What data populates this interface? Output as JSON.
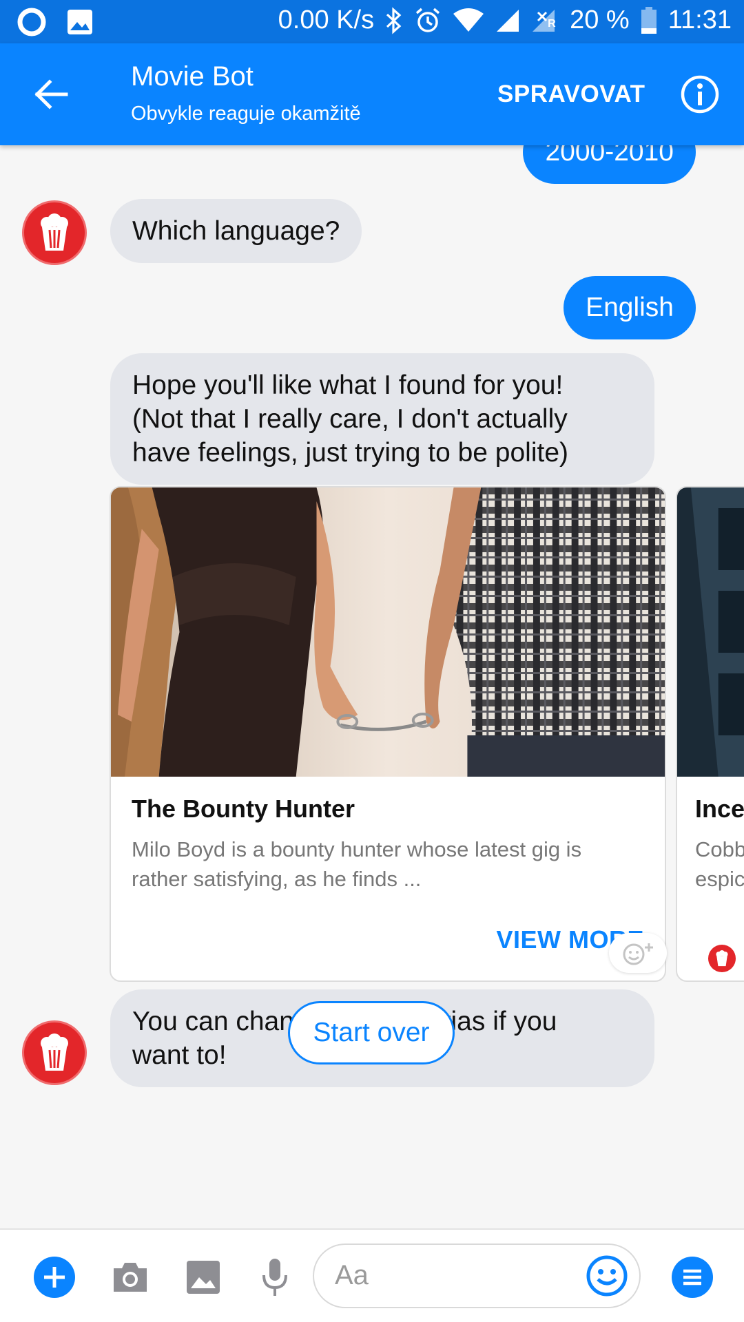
{
  "status_bar": {
    "speed": "0.00 K/s",
    "battery": "20 %",
    "time": "11:31",
    "network_label": "R"
  },
  "header": {
    "title": "Movie Bot",
    "subtitle": "Obvykle reaguje okamžitě",
    "manage_label": "SPRAVOVAT"
  },
  "messages": {
    "out_decade": "2000-2010",
    "bot_language_question": "Which language?",
    "out_language": "English",
    "bot_found_line1": "Hope you'll like what I found for you!",
    "bot_found_line2": "(Not that I really care, I don't actually",
    "bot_found_line3": "have feelings, just trying to be polite)",
    "bot_change_line1": "You can change your criterias if you",
    "bot_change_line2": "want to!"
  },
  "carousel": {
    "cards": [
      {
        "title": "The Bounty Hunter",
        "description_line1": "Milo Boyd is a bounty hunter whose latest gig is",
        "description_line2": "rather satisfying, as he finds ...",
        "button_label": "VIEW MORE"
      },
      {
        "title": "Ince",
        "description_line1": "Cobb",
        "description_line2": "espic"
      }
    ]
  },
  "quick_reply": {
    "label": "Start over"
  },
  "composer": {
    "placeholder": "Aa"
  },
  "colors": {
    "accent": "#0a84ff",
    "status_bar": "#0b73e0",
    "bot_avatar": "#e3262a",
    "incoming_bubble": "#e4e6eb"
  }
}
